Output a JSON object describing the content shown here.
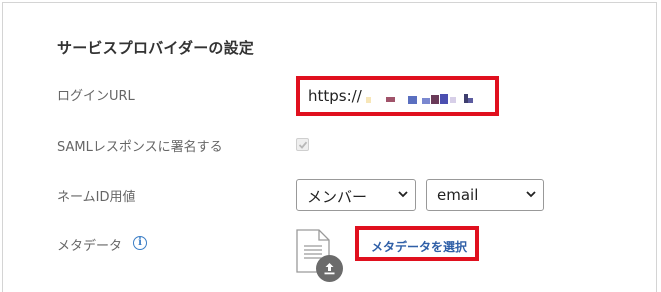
{
  "section": {
    "title": "サービスプロバイダーの設定"
  },
  "fields": {
    "login_url": {
      "label": "ログインURL",
      "value": "https://"
    },
    "saml_sign": {
      "label": "SAMLレスポンスに署名する",
      "checked": true
    },
    "name_id": {
      "label": "ネームID用値",
      "select_type": "メンバー",
      "select_attribute": "email"
    },
    "metadata": {
      "label": "メタデータ",
      "select_button": "メタデータを選択"
    }
  },
  "colors": {
    "highlight_border": "#e0101e",
    "link_blue": "#2f5fa7",
    "info_blue": "#3b7ec6"
  }
}
